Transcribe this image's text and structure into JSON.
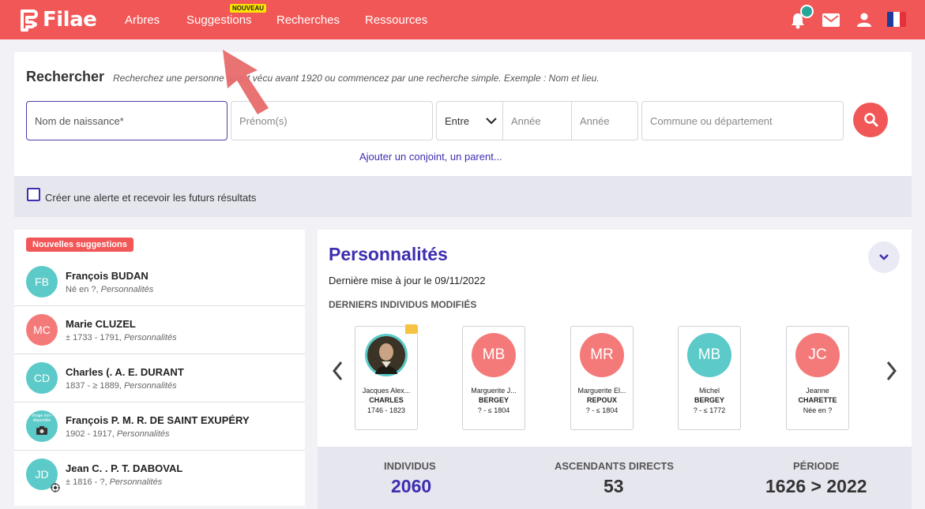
{
  "brand": {
    "name": "Filae",
    "accent": "#f25757",
    "primary": "#3d2eb0"
  },
  "nav": {
    "items": [
      "Arbres",
      "Suggestions",
      "Recherches",
      "Ressources"
    ],
    "badge": "NOUVEAU"
  },
  "header_icons": [
    "bell-icon",
    "mail-icon",
    "user-icon",
    "flag-fr-icon"
  ],
  "search": {
    "title": "Rechercher",
    "subtitle": "Recherchez une personne ayant vécu avant 1920 ou commencez par une recherche simple. Exemple : Nom et lieu.",
    "birth_name_placeholder": "Nom de naissance*",
    "first_name_placeholder": "Prénom(s)",
    "range_select": "Entre",
    "year_from_placeholder": "Année",
    "year_to_placeholder": "Année",
    "location_placeholder": "Commune ou département",
    "add_link": "Ajouter un conjoint, un parent...",
    "alert_label": "Créer une alerte et recevoir les futurs résultats"
  },
  "suggestions": {
    "badge": "Nouvelles suggestions",
    "items": [
      {
        "initials": "FB",
        "name": "François BUDAN",
        "meta": "Né en ?, ",
        "source": "Personnalités",
        "color": "#5bcac8"
      },
      {
        "initials": "MC",
        "name": "Marie CLUZEL",
        "meta": "± 1733 - 1791, ",
        "source": "Personnalités",
        "color": "#f47a7a"
      },
      {
        "initials": "CD",
        "name": "Charles (. A. E. DURANT",
        "meta": "1837 - ≥ 1889, ",
        "source": "Personnalités",
        "color": "#5bcac8"
      },
      {
        "initials": "",
        "name": "François P. M. R. DE SAINT EXUPÉRY",
        "meta": "1902 - 1917, ",
        "source": "Personnalités",
        "color": "#5bcac8",
        "image_text": "Image non-disponible"
      },
      {
        "initials": "JD",
        "name": "Jean C. . P. T. DABOVAL",
        "meta": "± 1816 - ?, ",
        "source": "Personnalités",
        "color": "#5bcac8"
      }
    ]
  },
  "personalities": {
    "title": "Personnalités",
    "updated": "Dernière mise à jour le 09/11/2022",
    "section": "DERNIERS INDIVIDUS MODIFIÉS",
    "cards": [
      {
        "initials": "",
        "first": "Jacques Alex...",
        "last": "CHARLES",
        "dates": "1746 - 1823",
        "color": "#5bcac8",
        "portrait": true
      },
      {
        "initials": "MB",
        "first": "Marguerite J...",
        "last": "BERGEY",
        "dates": "? - ≤ 1804",
        "color": "#f47a7a"
      },
      {
        "initials": "MR",
        "first": "Marguerite El...",
        "last": "REPOUX",
        "dates": "? - ≤ 1804",
        "color": "#f47a7a"
      },
      {
        "initials": "MB",
        "first": "Michel",
        "last": "BERGEY",
        "dates": "? - ≤ 1772",
        "color": "#5bcac8"
      },
      {
        "initials": "JC",
        "first": "Jeanne",
        "last": "CHARETTE",
        "dates": "Née en ?",
        "color": "#f47a7a"
      }
    ],
    "stats": [
      {
        "label": "INDIVIDUS",
        "value": "2060"
      },
      {
        "label": "ASCENDANTS DIRECTS",
        "value": "53"
      },
      {
        "label": "PÉRIODE",
        "value": "1626 > 2022"
      }
    ]
  }
}
